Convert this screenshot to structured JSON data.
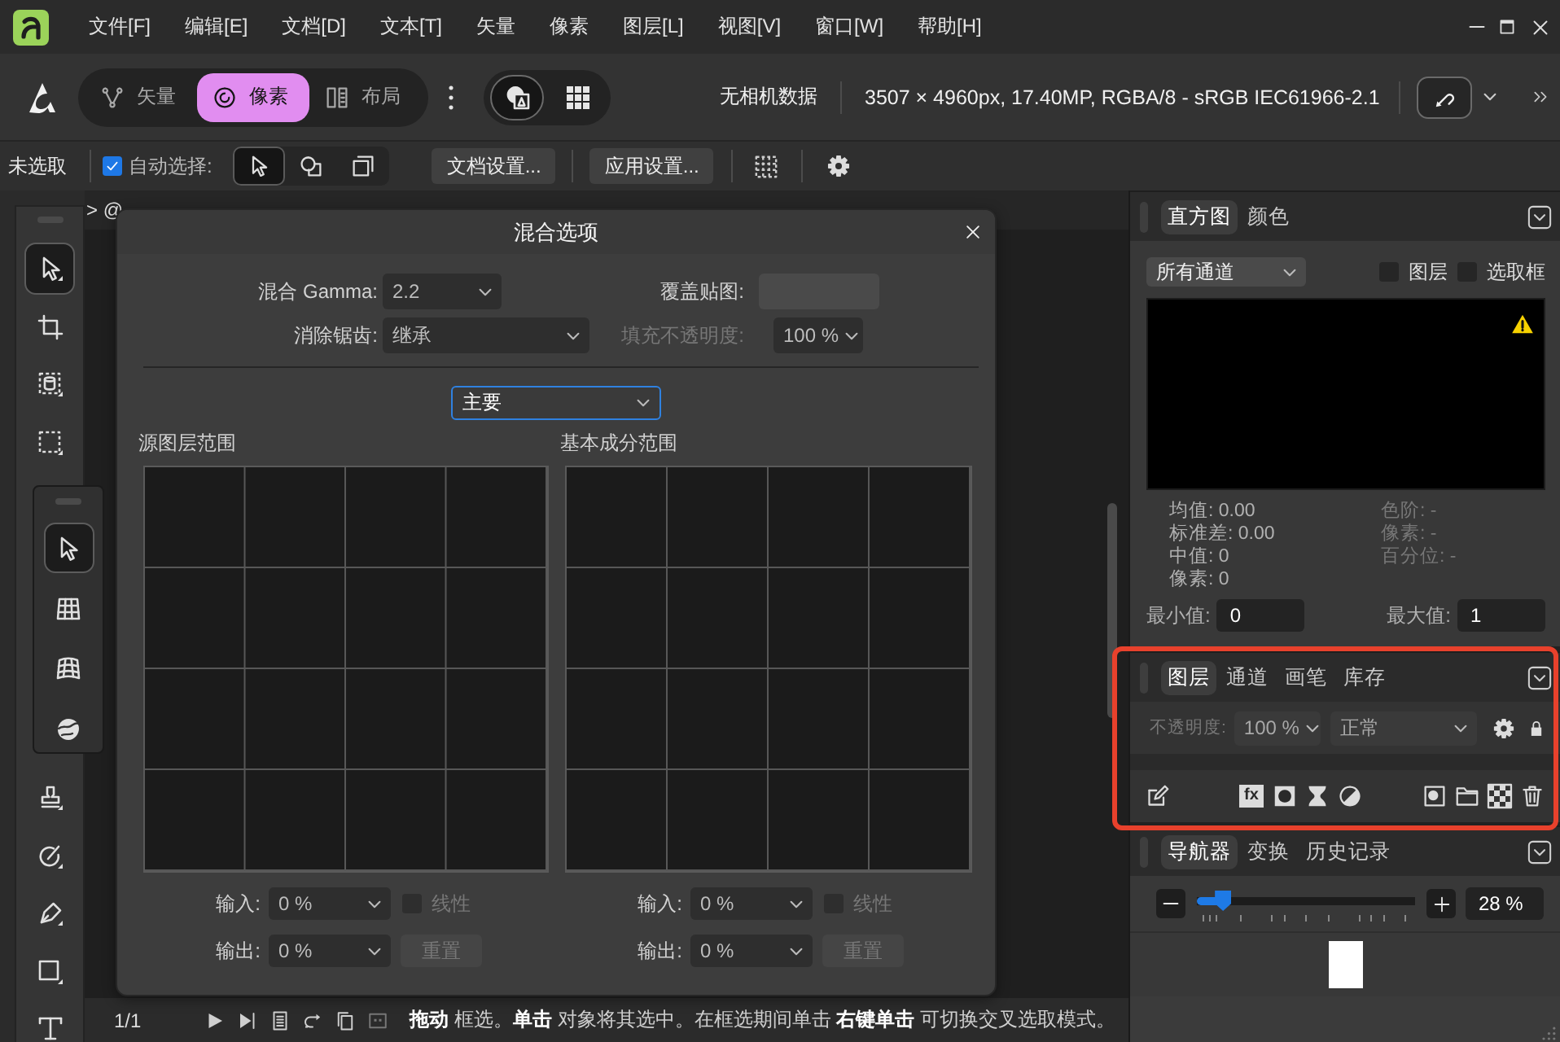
{
  "menu_bar": {
    "items": [
      "文件[F]",
      "编辑[E]",
      "文档[D]",
      "文本[T]",
      "矢量",
      "像素",
      "图层[L]",
      "视图[V]",
      "窗口[W]",
      "帮助[H]"
    ]
  },
  "toolbar": {
    "personas": [
      {
        "label": "矢量",
        "selected": false
      },
      {
        "label": "像素",
        "selected": true
      },
      {
        "label": "布局",
        "selected": false
      }
    ],
    "view_modes": [
      {
        "selected": true
      },
      {
        "selected": false
      }
    ],
    "camera_info": "无相机数据",
    "document_info": "3507 × 4960px, 17.40MP, RGBA/8 - sRGB IEC61966-2.1"
  },
  "context_bar": {
    "selection_status": "未选取",
    "auto_select": {
      "label": "自动选择:",
      "checked": true
    },
    "selection_modes": [
      {
        "selected": true
      },
      {
        "selected": false
      },
      {
        "selected": false
      }
    ],
    "buttons": [
      "文档设置...",
      "应用设置..."
    ]
  },
  "tools": [
    {
      "selected": true
    },
    {
      "selected": false
    },
    {
      "selected": false
    },
    {
      "selected": false
    },
    {
      "selected": false
    },
    {
      "selected": false
    },
    {
      "selected": false
    },
    {
      "selected": false
    },
    {
      "selected": false
    }
  ],
  "tool_flyout": [
    {
      "selected": true
    },
    {
      "selected": false
    },
    {
      "selected": false
    },
    {
      "selected": false
    }
  ],
  "document_tab": {
    "title": "> @"
  },
  "dialog": {
    "title": "混合选项",
    "blend_gamma": {
      "label": "混合 Gamma:",
      "value": "2.2"
    },
    "overlay_map": {
      "label": "覆盖贴图:"
    },
    "antialiasing": {
      "label": "消除锯齿:",
      "value": "继承"
    },
    "fill_opacity": {
      "label": "填充不透明度:",
      "value": "100 %",
      "disabled": true
    },
    "channel": "主要",
    "ranges": [
      {
        "title": "源图层范围",
        "input": {
          "label": "输入:",
          "value": "0 %"
        },
        "output": {
          "label": "输出:",
          "value": "0 %"
        },
        "linear": {
          "label": "线性",
          "checked": false,
          "disabled": true
        },
        "reset": {
          "label": "重置",
          "disabled": true
        }
      },
      {
        "title": "基本成分范围",
        "input": {
          "label": "输入:",
          "value": "0 %"
        },
        "output": {
          "label": "输出:",
          "value": "0 %"
        },
        "linear": {
          "label": "线性",
          "checked": false,
          "disabled": true
        },
        "reset": {
          "label": "重置",
          "disabled": true
        }
      }
    ]
  },
  "histogram_panel": {
    "tabs": [
      {
        "label": "直方图",
        "selected": true
      },
      {
        "label": "颜色",
        "selected": false
      }
    ],
    "channel": "所有通道",
    "options": [
      {
        "label": "图层",
        "checked": false
      },
      {
        "label": "选取框",
        "checked": false
      }
    ],
    "stats": {
      "column_1": [
        {
          "text": "均值: 0.00",
          "disabled": false
        },
        {
          "text": "标准差: 0.00",
          "disabled": false
        },
        {
          "text": "中值: 0",
          "disabled": false
        },
        {
          "text": "像素: 0",
          "disabled": false
        }
      ],
      "column_2": [
        {
          "text": "色阶: -",
          "disabled": true
        },
        {
          "text": "像素: -",
          "disabled": true
        },
        {
          "text": "百分位: -",
          "disabled": true
        }
      ]
    },
    "min": {
      "label": "最小值:",
      "value": "0"
    },
    "max": {
      "label": "最大值:",
      "value": "1"
    }
  },
  "layers_panel": {
    "highlighted": true,
    "tabs": [
      {
        "label": "图层",
        "selected": true
      },
      {
        "label": "通道",
        "selected": false
      },
      {
        "label": "画笔",
        "selected": false
      },
      {
        "label": "库存",
        "selected": false
      }
    ],
    "opacity": {
      "label": "不透明度:",
      "value": "100 %",
      "disabled": true
    },
    "blend_mode": "正常",
    "effects_label": "fx"
  },
  "navigator_panel": {
    "tabs": [
      {
        "label": "导航器",
        "selected": true
      },
      {
        "label": "变换",
        "selected": false
      },
      {
        "label": "历史记录",
        "selected": false
      }
    ],
    "zoom": {
      "level": 0.12,
      "value": "28 %"
    }
  },
  "status_bar": {
    "page": "1/1",
    "hint": "**拖动** 框选。**单击** 对象将其选中。在框选期间单击 **右键单击** 可切换交叉选取模式。"
  }
}
